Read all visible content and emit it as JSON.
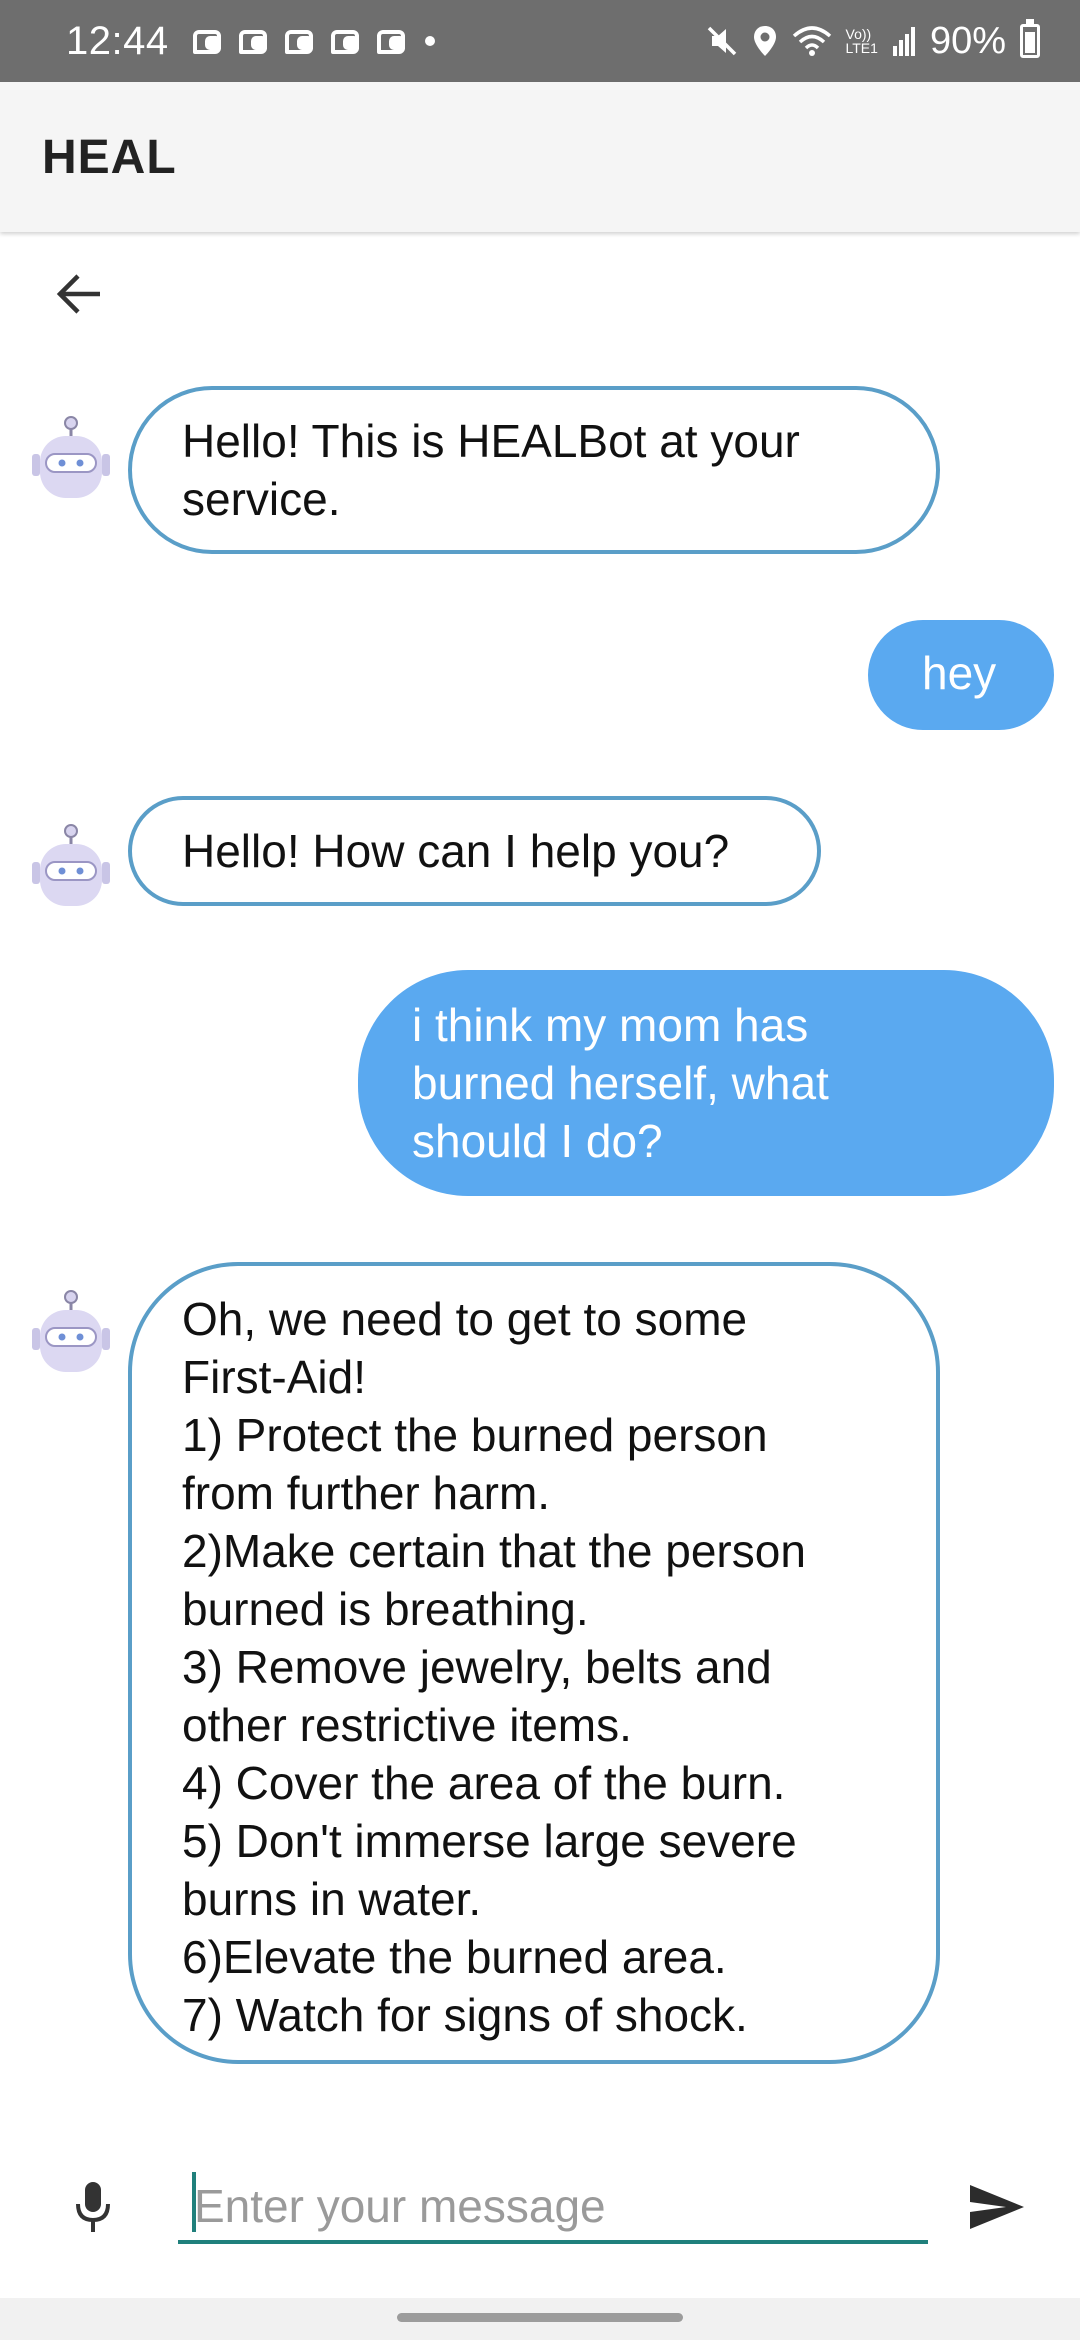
{
  "status_bar": {
    "time": "12:44",
    "lte_label_top": "Vo))",
    "lte_label_bottom": "LTE1",
    "battery": "90%"
  },
  "app_bar": {
    "title": "HEAL"
  },
  "chat": {
    "messages": [
      {
        "sender": "bot",
        "text": "Hello! This is HEALBot at your\nservice."
      },
      {
        "sender": "user",
        "text": "hey"
      },
      {
        "sender": "bot",
        "text": "Hello! How can I help you?"
      },
      {
        "sender": "user",
        "text": "i think my mom has\nburned herself, what\nshould I do?"
      },
      {
        "sender": "bot",
        "text": "Oh, we need to get to some\nFirst-Aid!\n1) Protect the burned person\nfrom further harm.\n2)Make certain that the person\nburned is breathing.\n3) Remove jewelry, belts and\nother restrictive items.\n4) Cover the area of the burn.\n5) Don't immerse large severe\nburns in water.\n6)Elevate the burned area.\n7) Watch for signs of shock."
      }
    ]
  },
  "composer": {
    "placeholder": "Enter your message",
    "value": ""
  },
  "colors": {
    "bot_bubble_border": "#5a9ec8",
    "user_bubble_fill": "#5aa9f0",
    "input_underline": "#20807c",
    "status_bar": "#6e6e6e",
    "app_bar": "#f5f5f5"
  }
}
